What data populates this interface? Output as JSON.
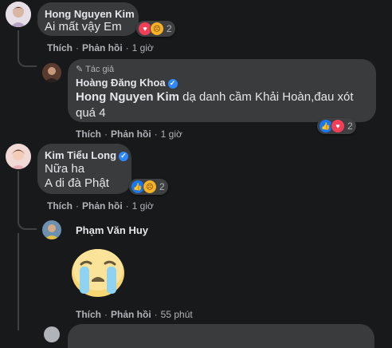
{
  "comments": [
    {
      "author": "Hong Nguyen Kim",
      "text": "Ai mất vậy Em",
      "reaction_count": "2",
      "actions": {
        "like": "Thích",
        "reply": "Phản hồi",
        "time": "1 giờ"
      }
    },
    {
      "badge": "Tác giả",
      "author": "Hoàng Đăng Khoa",
      "mention": "Hong Nguyen Kim",
      "text": " dạ danh cầm Khải Hoàn,đau xót quá 4",
      "reaction_count": "2",
      "actions": {
        "like": "Thích",
        "reply": "Phản hồi",
        "time": "1 giờ"
      }
    },
    {
      "author": "Kim Tiểu Long",
      "line1": "Nữa ha",
      "line2": "A di đà Phật",
      "reaction_count": "2",
      "actions": {
        "like": "Thích",
        "reply": "Phản hồi",
        "time": "1 giờ"
      }
    },
    {
      "author": "Phạm Văn Huy",
      "sticker": "crying-face-sticker",
      "actions": {
        "like": "Thích",
        "reply": "Phản hồi",
        "time": "55 phút"
      }
    }
  ],
  "colors": {
    "background": "#18191a",
    "bubble": "#3a3b3c",
    "link": "#2d88ff",
    "like": "#1877f2",
    "love": "#f33e58",
    "sad": "#f7b125"
  }
}
